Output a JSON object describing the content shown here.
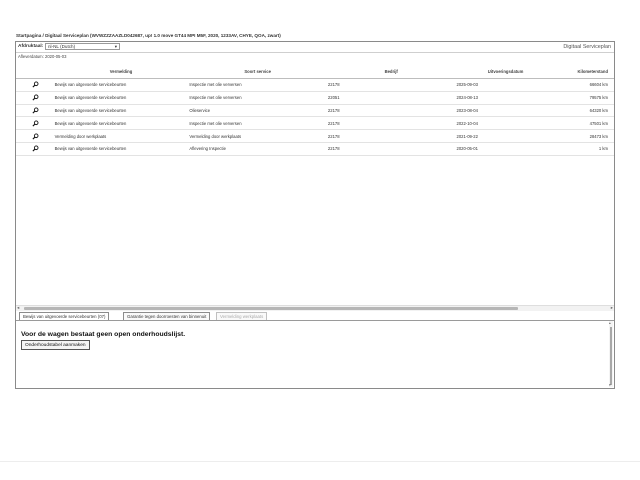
{
  "breadcrumb": "Startpagina / Digitaal Serviceplan (WVWZZZAAZLD042687, up! 1.0 move GT44 MPI M5F, 2020, 1233AV, CHYE, QOA, zwart)",
  "header": {
    "language_label": "Afdruktaal:",
    "language_value": "nl-NL (Dutch)",
    "app_title": "Digitaal Serviceplan",
    "print_date": "Afleverdatum: 2020-05-03"
  },
  "table": {
    "columns": [
      "",
      "Vermelding",
      "Soort service",
      "Bedrijf",
      "Uitvoeringsdatum",
      "Kilometerstand"
    ],
    "rows": [
      {
        "icon": "magnifier-icon",
        "action": "Bewijs van uitgevoerde servicebeurten",
        "service": "Inspectie met olie verversen",
        "company": "22178",
        "date": "2025-09-03",
        "km": "66604 km"
      },
      {
        "icon": "magnifier-icon",
        "action": "Bewijs van uitgevoerde servicebeurten",
        "service": "Inspectie met olie verversen",
        "company": "22051",
        "date": "2024-08-13",
        "km": "79575 km"
      },
      {
        "icon": "magnifier-icon",
        "action": "Bewijs van uitgevoerde servicebeurten",
        "service": "Olieservice",
        "company": "22178",
        "date": "2023-08-04",
        "km": "64320 km"
      },
      {
        "icon": "magnifier-icon",
        "action": "Bewijs van uitgevoerde servicebeurten",
        "service": "Inspectie met olie verversen",
        "company": "22178",
        "date": "2022-10-04",
        "km": "47501 km"
      },
      {
        "icon": "magnifier-icon",
        "action": "Vermelding door werkplaats",
        "service": "Vermelding door werkplaats",
        "company": "22178",
        "date": "2021-09-22",
        "km": "28473 km"
      },
      {
        "icon": "magnifier-icon",
        "action": "Bewijs van uitgevoerde servicebeurten",
        "service": "Aflevering Inspectie",
        "company": "22178",
        "date": "2020-05-01",
        "km": "1 km"
      }
    ]
  },
  "tabs": [
    {
      "label": "Bewijs van uitgevoerde servicebeurten (07)",
      "state": "active"
    },
    {
      "label": "Garantie tegen doorroesten van binnenuit",
      "state": "normal"
    },
    {
      "label": "Vermelding werkplaats",
      "state": "disabled"
    }
  ],
  "panel": {
    "message": "Voor de wagen bestaat geen open onderhoudslijst.",
    "button_label": "Onderhoudstabel aanmaken"
  },
  "colors": {
    "border": "#8a8a8a",
    "scrollbar_thumb": "#b6b6b6"
  }
}
